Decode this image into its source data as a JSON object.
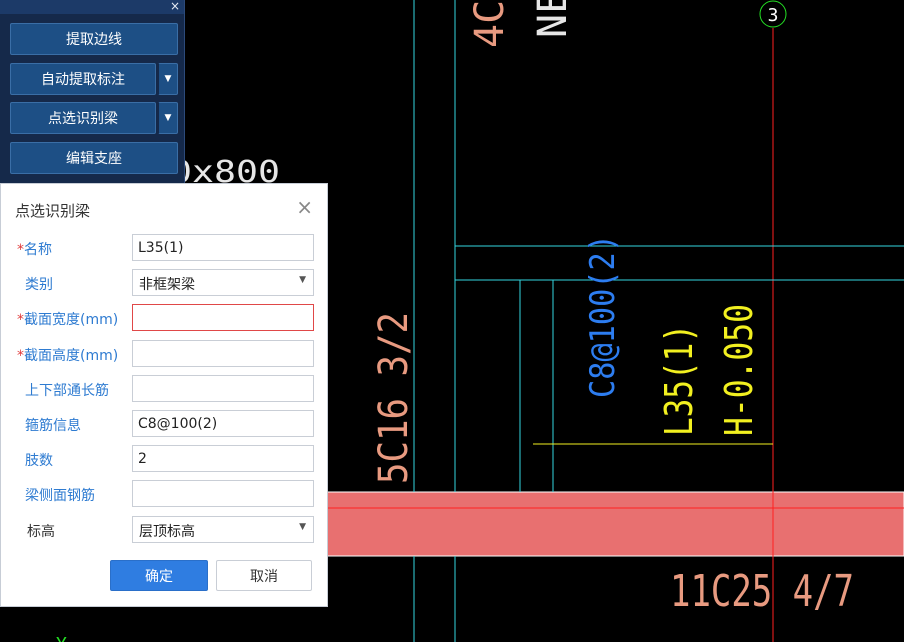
{
  "toolbar": {
    "close_glyph": "×",
    "buttons": [
      {
        "label": "提取边线"
      },
      {
        "label": "自动提取标注"
      },
      {
        "label": "点选识别梁"
      },
      {
        "label": "编辑支座"
      }
    ],
    "dropdown_glyph": "▼"
  },
  "dialog": {
    "title": "点选识别梁",
    "close_glyph": "×",
    "required_mark": "*",
    "fields": [
      {
        "label": "名称",
        "required": true,
        "value": "L35(1)"
      },
      {
        "label": "类别",
        "required": false,
        "value": "非框架梁"
      },
      {
        "label": "截面宽度(mm)",
        "required": true,
        "value": ""
      },
      {
        "label": "截面高度(mm)",
        "required": true,
        "value": ""
      },
      {
        "label": "上下部通长筋",
        "required": false,
        "value": ""
      },
      {
        "label": "箍筋信息",
        "required": false,
        "value": "C8@100(2)"
      },
      {
        "label": "肢数",
        "required": false,
        "value": "2"
      },
      {
        "label": "梁侧面钢筋",
        "required": false,
        "value": ""
      },
      {
        "label": "标高",
        "required": false,
        "value": "层顶标高"
      }
    ],
    "select_arrow": "▼",
    "ok_label": "确定",
    "cancel_label": "取消"
  },
  "cad": {
    "texts": {
      "top_partial_1": "4C",
      "top_partial_2": "NE",
      "axis_number": "3",
      "partial_dim": "0x800",
      "rebar_left": "5C16 3/2",
      "stirrup": "C8@100(2)",
      "beam_name": "L35(1)",
      "beam_elev": "H-0.050",
      "rebar_bottom": "11C25 4/7",
      "bottom_partial": "Y"
    },
    "colors": {
      "cyan": "#33d6e0",
      "red": "#ff2020",
      "beam_fill": "#e87070",
      "yellow": "#f2f020",
      "blue": "#2d7df0",
      "salmon": "#e89a80",
      "green": "#24e024"
    }
  }
}
